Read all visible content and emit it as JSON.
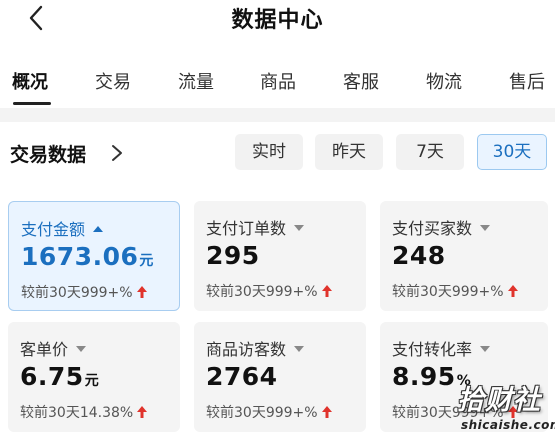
{
  "header": {
    "title": "数据中心",
    "back_icon": "chevron-left-icon"
  },
  "tabs": [
    {
      "label": "概况",
      "active": true
    },
    {
      "label": "交易"
    },
    {
      "label": "流量"
    },
    {
      "label": "商品"
    },
    {
      "label": "客服"
    },
    {
      "label": "物流"
    },
    {
      "label": "售后"
    }
  ],
  "section": {
    "title": "交易数据",
    "ranges": [
      {
        "label": "实时"
      },
      {
        "label": "昨天"
      },
      {
        "label": "7天"
      },
      {
        "label": "30天",
        "active": true
      }
    ]
  },
  "metrics": [
    {
      "label": "支付金额",
      "value": "1673.06",
      "unit": "元",
      "compare": "较前30天999+%",
      "active": true
    },
    {
      "label": "支付订单数",
      "value": "295",
      "unit": "",
      "compare": "较前30天999+%"
    },
    {
      "label": "支付买家数",
      "value": "248",
      "unit": "",
      "compare": "较前30天999+%"
    },
    {
      "label": "客单价",
      "value": "6.75",
      "unit": "元",
      "compare": "较前30天14.38%"
    },
    {
      "label": "商品访客数",
      "value": "2764",
      "unit": "",
      "compare": "较前30天999+%"
    },
    {
      "label": "支付转化率",
      "value": "8.95",
      "unit": "%",
      "compare": "较前30天999+%"
    }
  ],
  "watermark": {
    "main": "拾财社",
    "sub": "shicaishe.com"
  },
  "colors": {
    "accent": "#1b6fbf",
    "active_card_bg": "#eaf4ff",
    "card_bg": "#f4f4f4",
    "trend_up": "#e0332c"
  }
}
